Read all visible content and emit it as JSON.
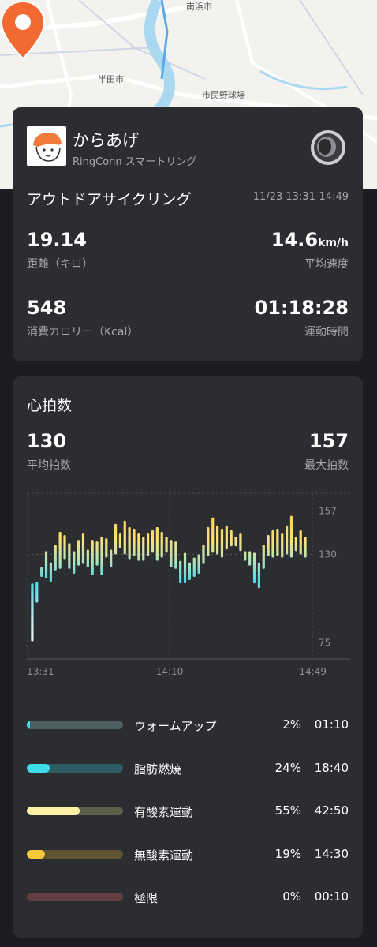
{
  "map": {
    "labels": [
      "半田市",
      "南浜市",
      "市民野球場"
    ]
  },
  "user": {
    "name": "からあげ",
    "device": "RingConn スマートリング"
  },
  "activity": {
    "title": "アウトドアサイクリング",
    "time_range": "11/23 13:31-14:49"
  },
  "stats": {
    "distance": {
      "value": "19.14",
      "label": "距離（キロ）"
    },
    "speed": {
      "value": "14.6",
      "unit": "km/h",
      "label": "平均速度"
    },
    "calories": {
      "value": "548",
      "label": "消費カロリー（Kcal）"
    },
    "duration": {
      "value": "01:18:28",
      "label": "運動時間"
    }
  },
  "heart_rate": {
    "title": "心拍数",
    "avg": {
      "value": "130",
      "label": "平均拍数"
    },
    "max": {
      "value": "157",
      "label": "最大拍数"
    }
  },
  "chart_data": {
    "type": "bar",
    "y_ticks": [
      "157",
      "130",
      "75"
    ],
    "x_ticks": [
      "13:31",
      "14:10",
      "14:49"
    ],
    "ylim": [
      65,
      168
    ],
    "ranges": [
      [
        76,
        112
      ],
      [
        100,
        113
      ],
      [
        116,
        122
      ],
      [
        115,
        132
      ],
      [
        113,
        125
      ],
      [
        120,
        136
      ],
      [
        121,
        144
      ],
      [
        127,
        142
      ],
      [
        121,
        137
      ],
      [
        118,
        132
      ],
      [
        123,
        139
      ],
      [
        124,
        143
      ],
      [
        122,
        133
      ],
      [
        117,
        139
      ],
      [
        123,
        138
      ],
      [
        117,
        141
      ],
      [
        128,
        140
      ],
      [
        122,
        133
      ],
      [
        130,
        149
      ],
      [
        134,
        143
      ],
      [
        130,
        151
      ],
      [
        127,
        147
      ],
      [
        129,
        146
      ],
      [
        126,
        143
      ],
      [
        126,
        141
      ],
      [
        129,
        143
      ],
      [
        131,
        145
      ],
      [
        126,
        147
      ],
      [
        128,
        144
      ],
      [
        131,
        141
      ],
      [
        122,
        139
      ],
      [
        121,
        138
      ],
      [
        112,
        126
      ],
      [
        112,
        131
      ],
      [
        114,
        125
      ],
      [
        116,
        128
      ],
      [
        118,
        130
      ],
      [
        124,
        136
      ],
      [
        129,
        147
      ],
      [
        131,
        153
      ],
      [
        130,
        148
      ],
      [
        128,
        146
      ],
      [
        133,
        148
      ],
      [
        135,
        145
      ],
      [
        135,
        141
      ],
      [
        132,
        143
      ],
      [
        126,
        132
      ],
      [
        123,
        132
      ],
      [
        112,
        131
      ],
      [
        109,
        125
      ],
      [
        121,
        136
      ],
      [
        129,
        142
      ],
      [
        128,
        145
      ],
      [
        129,
        146
      ],
      [
        128,
        143
      ],
      [
        130,
        148
      ],
      [
        128,
        154
      ],
      [
        132,
        141
      ],
      [
        130,
        145
      ],
      [
        128,
        141
      ]
    ],
    "zone_colors": {
      "low": "#f7f7f7",
      "warm": "#4fd6e5",
      "fat": "#8ad8c8",
      "aero": "#f9e27a",
      "anaero": "#f9c84a"
    }
  },
  "zones": [
    {
      "name": "ウォームアップ",
      "percent": "2%",
      "pct_value": 0.02,
      "time": "01:10",
      "color": "#4fd6e5",
      "track": "#4d5e62"
    },
    {
      "name": "脂肪燃焼",
      "percent": "24%",
      "pct_value": 0.24,
      "time": "18:40",
      "color": "#3fdde9",
      "track": "#2d5c63"
    },
    {
      "name": "有酸素運動",
      "percent": "55%",
      "pct_value": 0.55,
      "time": "42:50",
      "color": "#fbf0a3",
      "track": "#5d5d4b"
    },
    {
      "name": "無酸素運動",
      "percent": "19%",
      "pct_value": 0.19,
      "time": "14:30",
      "color": "#f7c83a",
      "track": "#5f5331"
    },
    {
      "name": "極限",
      "percent": "0%",
      "pct_value": 0.0,
      "time": "00:10",
      "color": "#a44a4a",
      "track": "#643d40"
    }
  ]
}
